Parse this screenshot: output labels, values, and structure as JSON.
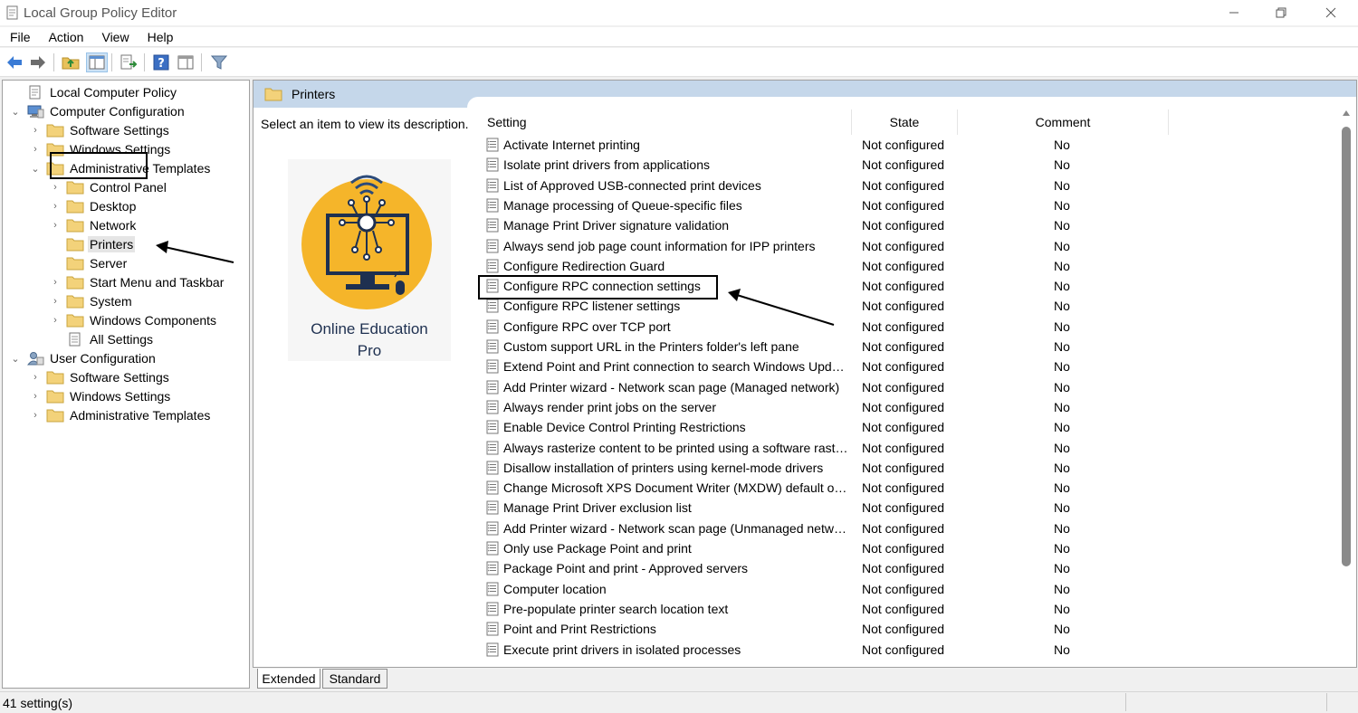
{
  "window": {
    "title": "Local Group Policy Editor",
    "minimize_icon": "minimize-icon",
    "maximize_icon": "restore-icon",
    "close_icon": "close-icon"
  },
  "menu": [
    "File",
    "Action",
    "View",
    "Help"
  ],
  "toolbar": [
    "back-arrow-icon",
    "forward-arrow-icon",
    "up-folder-icon",
    "show-hide-console-tree-icon",
    "export-list-icon",
    "help-icon",
    "show-action-pane-icon",
    "filter-icon"
  ],
  "tree": [
    {
      "label": "Local Computer Policy",
      "level": 0,
      "icon": "policy-icon",
      "expander": ""
    },
    {
      "label": "Computer Configuration",
      "level": 0,
      "icon": "computer-icon",
      "expander": "down"
    },
    {
      "label": "Software Settings",
      "level": 1,
      "icon": "folder-icon",
      "expander": "right"
    },
    {
      "label": "Windows Settings",
      "level": 1,
      "icon": "folder-icon",
      "expander": "right"
    },
    {
      "label": "Administrative Templates",
      "level": 1,
      "icon": "folder-icon",
      "expander": "down"
    },
    {
      "label": "Control Panel",
      "level": 2,
      "icon": "folder-icon",
      "expander": "right"
    },
    {
      "label": "Desktop",
      "level": 2,
      "icon": "folder-icon",
      "expander": "right"
    },
    {
      "label": "Network",
      "level": 2,
      "icon": "folder-icon",
      "expander": "right"
    },
    {
      "label": "Printers",
      "level": 2,
      "icon": "folder-icon",
      "expander": "",
      "selected": true
    },
    {
      "label": "Server",
      "level": 2,
      "icon": "folder-icon",
      "expander": ""
    },
    {
      "label": "Start Menu and Taskbar",
      "level": 2,
      "icon": "folder-icon",
      "expander": "right"
    },
    {
      "label": "System",
      "level": 2,
      "icon": "folder-icon",
      "expander": "right"
    },
    {
      "label": "Windows Components",
      "level": 2,
      "icon": "folder-icon",
      "expander": "right"
    },
    {
      "label": "All Settings",
      "level": 2,
      "icon": "all-settings-icon",
      "expander": ""
    },
    {
      "label": "User Configuration",
      "level": 0,
      "icon": "user-icon",
      "expander": "down"
    },
    {
      "label": "Software Settings",
      "level": 1,
      "icon": "folder-icon",
      "expander": "right"
    },
    {
      "label": "Windows Settings",
      "level": 1,
      "icon": "folder-icon",
      "expander": "right"
    },
    {
      "label": "Administrative Templates",
      "level": 1,
      "icon": "folder-icon",
      "expander": "right"
    }
  ],
  "right_pane": {
    "header": "Printers",
    "description_prompt": "Select an item to view its description.",
    "logo": {
      "line1": "Online Education",
      "line2": "Pro",
      "brand_color": "#f5b52a",
      "text_color": "#1e3050"
    },
    "columns": {
      "setting": "Setting",
      "state": "State",
      "comment": "Comment"
    },
    "rows": [
      {
        "setting": "Activate Internet printing",
        "state": "Not configured",
        "comment": "No"
      },
      {
        "setting": "Isolate print drivers from applications",
        "state": "Not configured",
        "comment": "No"
      },
      {
        "setting": "List of Approved USB-connected print devices",
        "state": "Not configured",
        "comment": "No"
      },
      {
        "setting": "Manage processing of Queue-specific files",
        "state": "Not configured",
        "comment": "No"
      },
      {
        "setting": "Manage Print Driver signature validation",
        "state": "Not configured",
        "comment": "No"
      },
      {
        "setting": "Always send job page count information for IPP printers",
        "state": "Not configured",
        "comment": "No"
      },
      {
        "setting": "Configure Redirection Guard",
        "state": "Not configured",
        "comment": "No"
      },
      {
        "setting": "Configure RPC connection settings",
        "state": "Not configured",
        "comment": "No"
      },
      {
        "setting": "Configure RPC listener settings",
        "state": "Not configured",
        "comment": "No"
      },
      {
        "setting": "Configure RPC over TCP port",
        "state": "Not configured",
        "comment": "No"
      },
      {
        "setting": "Custom support URL in the Printers folder's left pane",
        "state": "Not configured",
        "comment": "No"
      },
      {
        "setting": "Extend Point and Print connection to search Windows Update",
        "state": "Not configured",
        "comment": "No"
      },
      {
        "setting": "Add Printer wizard - Network scan page (Managed network)",
        "state": "Not configured",
        "comment": "No"
      },
      {
        "setting": "Always render print jobs on the server",
        "state": "Not configured",
        "comment": "No"
      },
      {
        "setting": "Enable Device Control Printing Restrictions",
        "state": "Not configured",
        "comment": "No"
      },
      {
        "setting": "Always rasterize content to be printed using a software rasteri...",
        "state": "Not configured",
        "comment": "No"
      },
      {
        "setting": "Disallow installation of printers using kernel-mode drivers",
        "state": "Not configured",
        "comment": "No"
      },
      {
        "setting": "Change Microsoft XPS Document Writer (MXDW) default out...",
        "state": "Not configured",
        "comment": "No"
      },
      {
        "setting": "Manage Print Driver exclusion list",
        "state": "Not configured",
        "comment": "No"
      },
      {
        "setting": "Add Printer wizard - Network scan page (Unmanaged network)",
        "state": "Not configured",
        "comment": "No"
      },
      {
        "setting": "Only use Package Point and print",
        "state": "Not configured",
        "comment": "No"
      },
      {
        "setting": "Package Point and print - Approved servers",
        "state": "Not configured",
        "comment": "No"
      },
      {
        "setting": "Computer location",
        "state": "Not configured",
        "comment": "No"
      },
      {
        "setting": "Pre-populate printer search location text",
        "state": "Not configured",
        "comment": "No"
      },
      {
        "setting": "Point and Print Restrictions",
        "state": "Not configured",
        "comment": "No"
      },
      {
        "setting": "Execute print drivers in isolated processes",
        "state": "Not configured",
        "comment": "No"
      }
    ]
  },
  "tabs": [
    "Extended",
    "Standard"
  ],
  "status": {
    "count": "41 setting(s)"
  }
}
